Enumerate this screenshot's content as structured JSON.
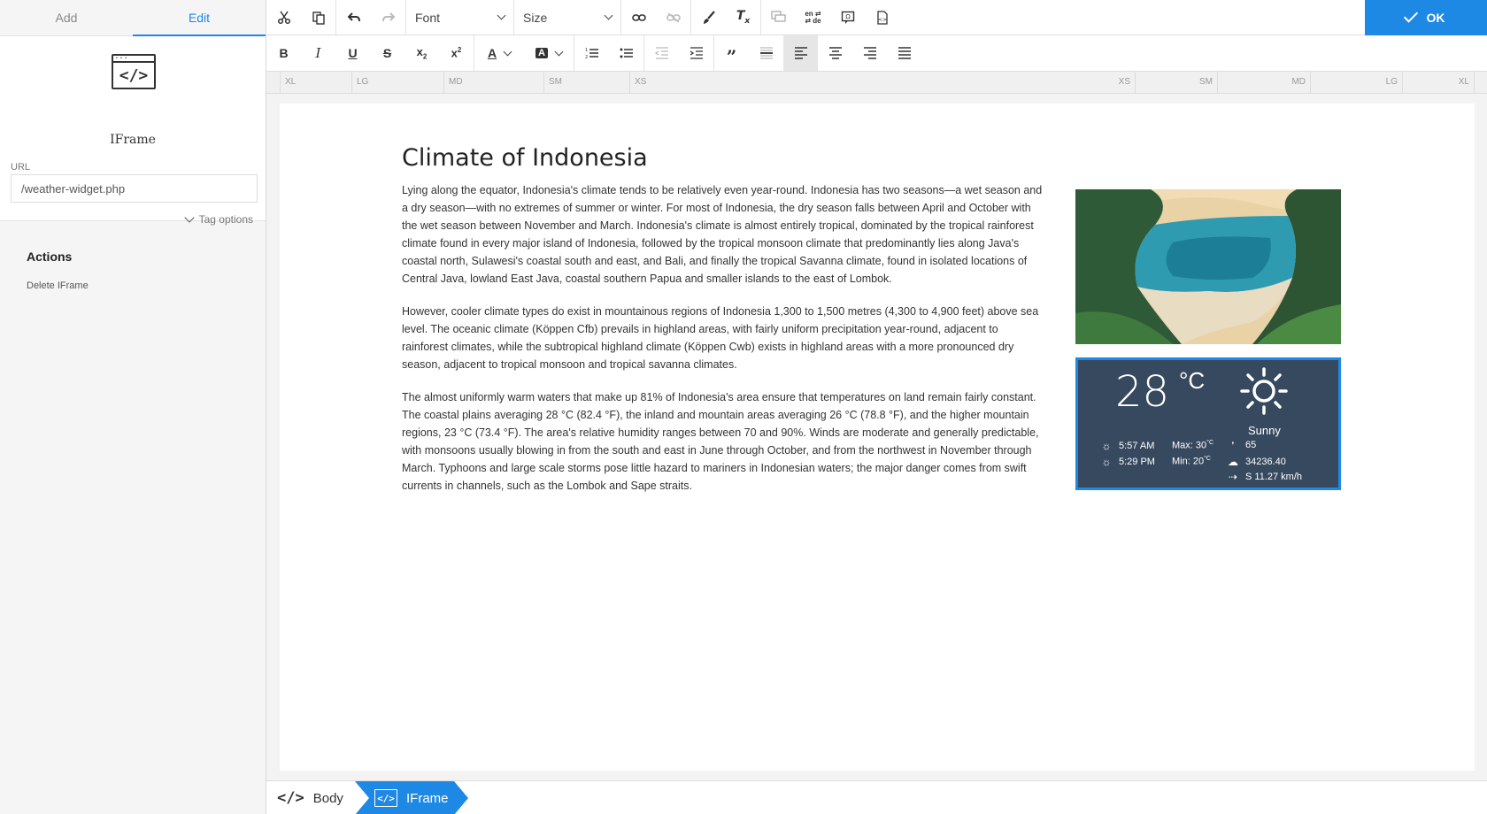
{
  "left_panel": {
    "tabs": [
      {
        "label": "Add",
        "active": false
      },
      {
        "label": "Edit",
        "active": true
      }
    ],
    "element": {
      "icon": "iframe-code-icon",
      "title": "IFrame"
    },
    "url": {
      "label": "URL",
      "value": "/weather-widget.php"
    },
    "tag_options_label": "Tag options",
    "actions": {
      "title": "Actions",
      "delete_label": "Delete IFrame"
    }
  },
  "toolbar": {
    "font_label": "Font",
    "size_label": "Size",
    "ok_label": "OK",
    "accent_color": "#1e88e5"
  },
  "ruler": {
    "marks": [
      "XL",
      "LG",
      "MD",
      "SM",
      "XS",
      "XS",
      "SM",
      "MD",
      "LG",
      "XL"
    ]
  },
  "article": {
    "title": "Climate of Indonesia",
    "paragraphs": [
      "Lying along the equator, Indonesia's climate tends to be relatively even year-round. Indonesia has two seasons—a wet season and a dry season—with no extremes of summer or winter. For most of Indonesia, the dry season falls between April and October with the wet season between November and March. Indonesia's climate is almost entirely tropical, dominated by the tropical rainforest climate found in every major island of Indonesia, followed by the tropical monsoon climate that predominantly lies along Java's coastal north, Sulawesi's coastal south and east, and Bali, and finally the tropical Savanna climate, found in isolated locations of Central Java, lowland East Java, coastal southern Papua and smaller islands to the east of Lombok.",
      "However, cooler climate types do exist in mountainous regions of Indonesia 1,300 to 1,500 metres (4,300 to 4,900 feet) above sea level. The oceanic climate (Köppen Cfb) prevails in highland areas, with fairly uniform precipitation year-round, adjacent to rainforest climates, while the subtropical highland climate (Köppen Cwb) exists in highland areas with a more pronounced dry season, adjacent to tropical monsoon and tropical savanna climates.",
      "The almost uniformly warm waters that make up 81% of Indonesia's area ensure that temperatures on land remain fairly constant. The coastal plains averaging 28 °C (82.4 °F), the inland and mountain areas averaging 26 °C (78.8 °F), and the higher mountain regions, 23 °C (73.4 °F). The area's relative humidity ranges between 70 and 90%. Winds are moderate and generally predictable, with monsoons usually blowing in from the south and east in June through October, and from the northwest in November through March. Typhoons and large scale storms pose little hazard to mariners in Indonesian waters; the major danger comes from swift currents in channels, such as the Lombok and Sape straits."
    ]
  },
  "weather": {
    "temperature": "28",
    "unit": "°C",
    "condition": "Sunny",
    "sunrise": "5:57 AM",
    "sunset": "5:29 PM",
    "max": "Max: 30",
    "min": "Min: 20",
    "deg_unit": "°C",
    "humidity": "65",
    "pressure": "34236.40",
    "wind": "S 11.27 km/h",
    "bg_color": "#36495f"
  },
  "breadcrumb": {
    "items": [
      {
        "label": "Body",
        "active": false
      },
      {
        "label": "IFrame",
        "active": true
      }
    ]
  }
}
